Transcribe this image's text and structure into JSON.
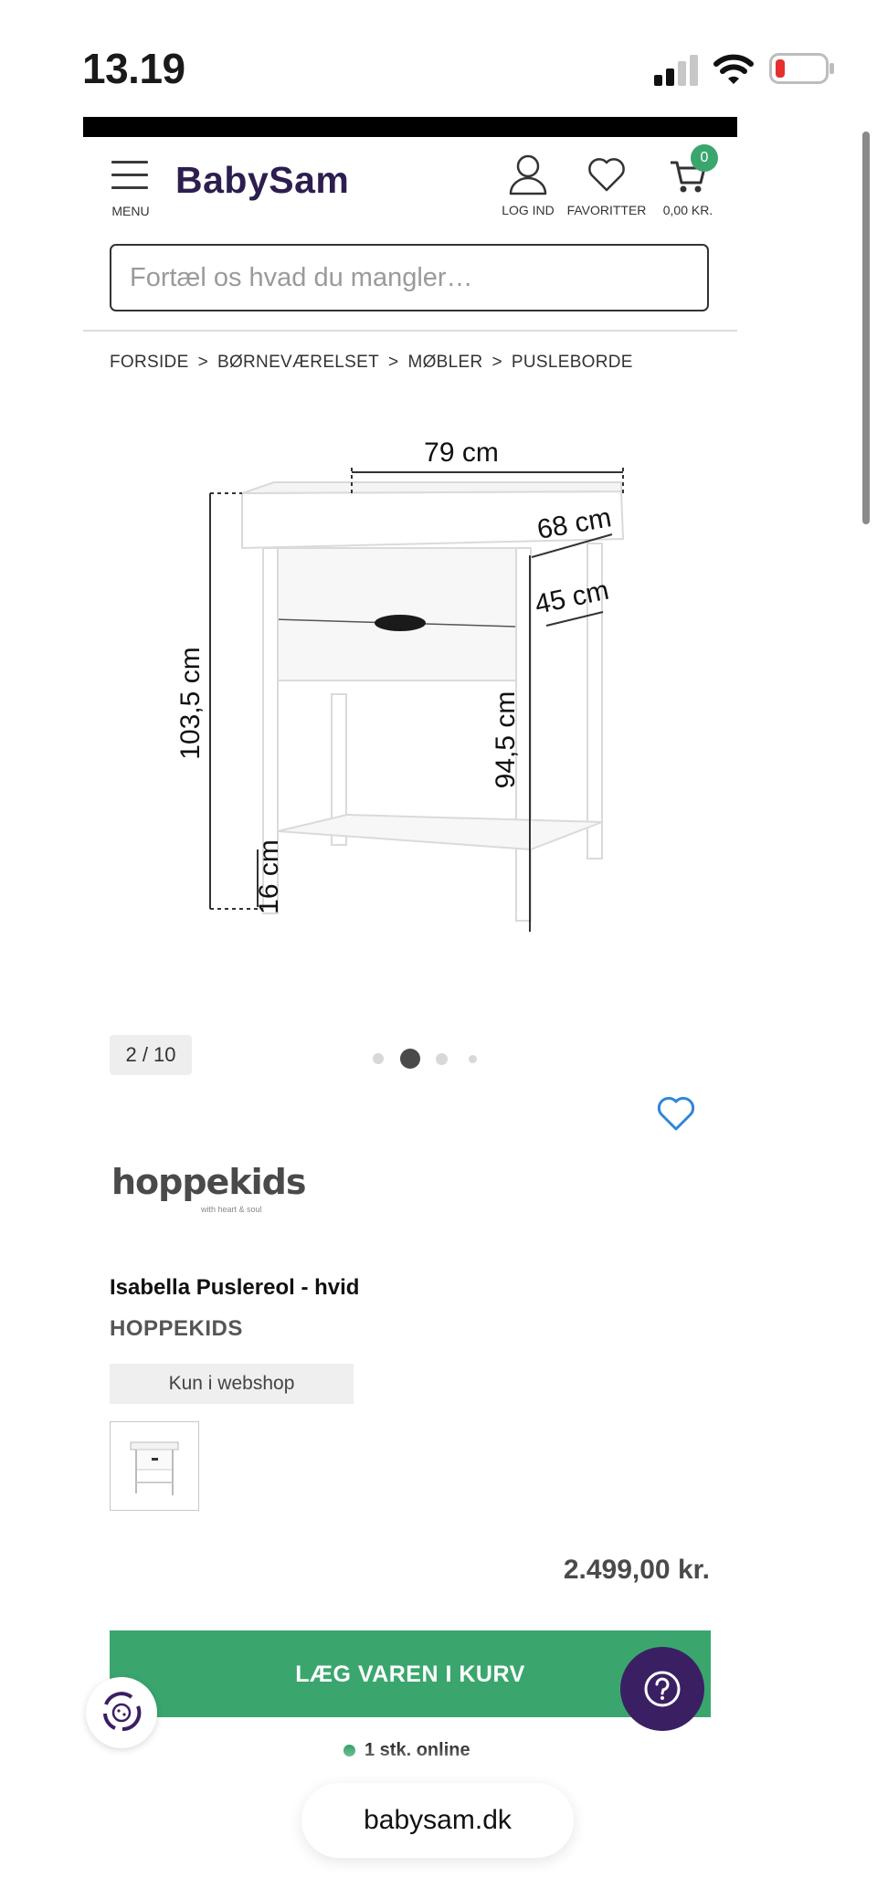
{
  "status_bar": {
    "time": "13.19"
  },
  "header": {
    "menu_label": "MENU",
    "logo": "BabySam",
    "login_label": "LOG IND",
    "favorites_label": "FAVORITTER",
    "cart_label": "0,00 KR.",
    "cart_count": "0",
    "search_placeholder": "Fortæl os hvad du mangler…"
  },
  "breadcrumb": [
    "FORSIDE",
    "BØRNEVÆRELSET",
    "MØBLER",
    "PUSLEBORDE"
  ],
  "gallery": {
    "counter": "2 / 10",
    "dimensions": {
      "width": "79 cm",
      "depth": "68 cm",
      "drawer_depth": "45 cm",
      "height": "103,5 cm",
      "inner_height": "94,5 cm",
      "shelf_height": "16 cm"
    },
    "active_dot": 1
  },
  "product": {
    "brand_logo_text": "hoppekids",
    "brand_logo_tagline": "with heart & soul",
    "title": "Isabella Puslereol - hvid",
    "brand": "HOPPEKIDS",
    "badge": "Kun i webshop",
    "price": "2.499,00 kr.",
    "add_to_cart": "LÆG VAREN I KURV",
    "stock": "1 stk. online"
  },
  "browser": {
    "url": "babysam.dk"
  },
  "colors": {
    "brand_purple": "#2d1e4f",
    "accent_green": "#3aa66e",
    "help_purple": "#3b1f63",
    "favorite_blue": "#2f86d8"
  }
}
